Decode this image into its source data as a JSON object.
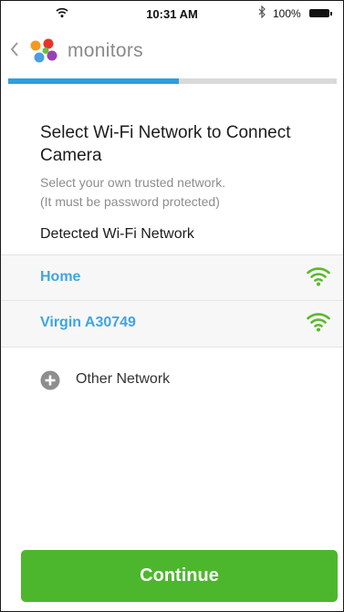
{
  "status_bar": {
    "time": "10:31 AM",
    "battery": "100%",
    "icons": [
      "wifi-icon",
      "bluetooth-icon",
      "battery-icon"
    ]
  },
  "header": {
    "back_icon": "chevron-left-icon",
    "logo_icon": "monitors-logo-icon",
    "title": "monitors"
  },
  "progress": {
    "fraction": 0.52,
    "color": "#2c9fe0"
  },
  "content": {
    "heading": "Select Wi-Fi Network to Connect Camera",
    "subtext_line1": "Select your own trusted network.",
    "subtext_line2": "(It must be password protected)",
    "detected_label": "Detected Wi-Fi Network"
  },
  "networks": [
    {
      "name": "Home",
      "signal_icon": "wifi-signal-icon"
    },
    {
      "name": "Virgin A30749",
      "signal_icon": "wifi-signal-icon"
    }
  ],
  "other_network": {
    "icon": "plus-circle-icon",
    "label": "Other Network"
  },
  "continue_button": {
    "label": "Continue",
    "color": "#4cb72c"
  },
  "colors": {
    "accent_blue": "#3fa5e0",
    "wifi_green": "#5cb82c",
    "muted_text": "#8d8d8d"
  }
}
